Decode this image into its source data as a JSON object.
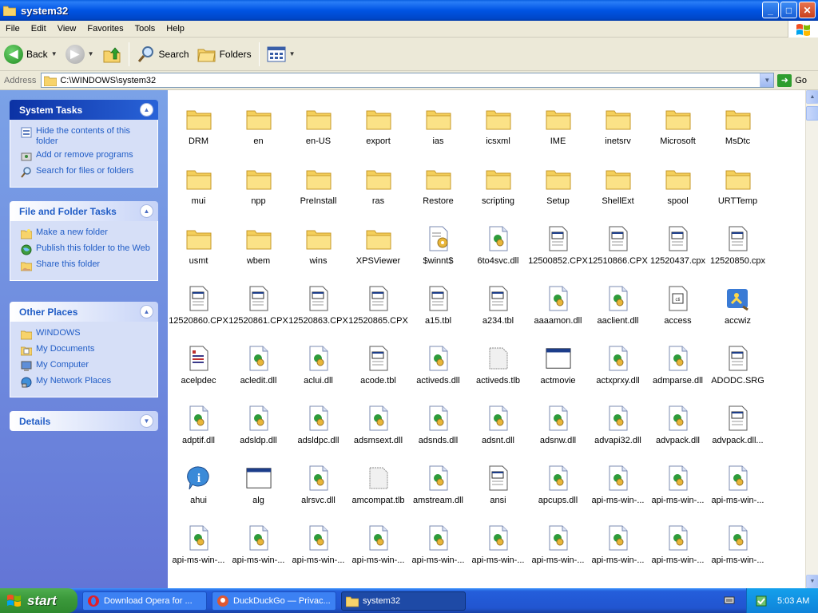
{
  "window": {
    "title": "system32",
    "buttons": {
      "minimize": "_",
      "maximize": "□",
      "close": "✕"
    }
  },
  "menu": [
    "File",
    "Edit",
    "View",
    "Favorites",
    "Tools",
    "Help"
  ],
  "toolbar": {
    "back": "Back",
    "search": "Search",
    "folders": "Folders"
  },
  "address": {
    "label": "Address",
    "path": "C:\\WINDOWS\\system32",
    "go": "Go"
  },
  "taskpane": {
    "system_tasks": {
      "title": "System Tasks",
      "items": [
        "Hide the contents of this folder",
        "Add or remove programs",
        "Search for files or folders"
      ]
    },
    "file_folder_tasks": {
      "title": "File and Folder Tasks",
      "items": [
        "Make a new folder",
        "Publish this folder to the Web",
        "Share this folder"
      ]
    },
    "other_places": {
      "title": "Other Places",
      "items": [
        "WINDOWS",
        "My Documents",
        "My Computer",
        "My Network Places"
      ]
    },
    "details": {
      "title": "Details"
    }
  },
  "files": [
    {
      "name": "DRM",
      "type": "folder"
    },
    {
      "name": "en",
      "type": "folder"
    },
    {
      "name": "en-US",
      "type": "folder"
    },
    {
      "name": "export",
      "type": "folder"
    },
    {
      "name": "ias",
      "type": "folder"
    },
    {
      "name": "icsxml",
      "type": "folder"
    },
    {
      "name": "IME",
      "type": "folder"
    },
    {
      "name": "inetsrv",
      "type": "folder"
    },
    {
      "name": "Microsoft",
      "type": "folder"
    },
    {
      "name": "MsDtc",
      "type": "folder"
    },
    {
      "name": "mui",
      "type": "folder"
    },
    {
      "name": "npp",
      "type": "folder"
    },
    {
      "name": "PreInstall",
      "type": "folder"
    },
    {
      "name": "ras",
      "type": "folder"
    },
    {
      "name": "Restore",
      "type": "folder"
    },
    {
      "name": "scripting",
      "type": "folder"
    },
    {
      "name": "Setup",
      "type": "folder"
    },
    {
      "name": "ShellExt",
      "type": "folder"
    },
    {
      "name": "spool",
      "type": "folder"
    },
    {
      "name": "URTTemp",
      "type": "folder"
    },
    {
      "name": "usmt",
      "type": "folder"
    },
    {
      "name": "wbem",
      "type": "folder"
    },
    {
      "name": "wins",
      "type": "folder"
    },
    {
      "name": "XPSViewer",
      "type": "folder"
    },
    {
      "name": "$winnt$",
      "type": "config"
    },
    {
      "name": "6to4svc.dll",
      "type": "dll"
    },
    {
      "name": "12500852.CPX",
      "type": "cpx"
    },
    {
      "name": "12510866.CPX",
      "type": "cpx"
    },
    {
      "name": "12520437.cpx",
      "type": "cpx"
    },
    {
      "name": "12520850.cpx",
      "type": "cpx"
    },
    {
      "name": "12520860.CPX",
      "type": "cpx"
    },
    {
      "name": "12520861.CPX",
      "type": "cpx"
    },
    {
      "name": "12520863.CPX",
      "type": "cpx"
    },
    {
      "name": "12520865.CPX",
      "type": "cpx"
    },
    {
      "name": "a15.tbl",
      "type": "cpx"
    },
    {
      "name": "a234.tbl",
      "type": "cpx"
    },
    {
      "name": "aaaamon.dll",
      "type": "dll"
    },
    {
      "name": "aaclient.dll",
      "type": "dll"
    },
    {
      "name": "access",
      "type": "cpl"
    },
    {
      "name": "accwiz",
      "type": "accwiz"
    },
    {
      "name": "acelpdec",
      "type": "codec"
    },
    {
      "name": "acledit.dll",
      "type": "dll"
    },
    {
      "name": "aclui.dll",
      "type": "dll"
    },
    {
      "name": "acode.tbl",
      "type": "cpx"
    },
    {
      "name": "activeds.dll",
      "type": "dll"
    },
    {
      "name": "activeds.tlb",
      "type": "tlb"
    },
    {
      "name": "actmovie",
      "type": "exe"
    },
    {
      "name": "actxprxy.dll",
      "type": "dll"
    },
    {
      "name": "admparse.dll",
      "type": "dll"
    },
    {
      "name": "ADODC.SRG",
      "type": "cpx"
    },
    {
      "name": "adptif.dll",
      "type": "dll"
    },
    {
      "name": "adsldp.dll",
      "type": "dll"
    },
    {
      "name": "adsldpc.dll",
      "type": "dll"
    },
    {
      "name": "adsmsext.dll",
      "type": "dll"
    },
    {
      "name": "adsnds.dll",
      "type": "dll"
    },
    {
      "name": "adsnt.dll",
      "type": "dll"
    },
    {
      "name": "adsnw.dll",
      "type": "dll"
    },
    {
      "name": "advapi32.dll",
      "type": "dll"
    },
    {
      "name": "advpack.dll",
      "type": "dll"
    },
    {
      "name": "advpack.dll...",
      "type": "cpx"
    },
    {
      "name": "ahui",
      "type": "info"
    },
    {
      "name": "alg",
      "type": "exe"
    },
    {
      "name": "alrsvc.dll",
      "type": "dll"
    },
    {
      "name": "amcompat.tlb",
      "type": "tlb"
    },
    {
      "name": "amstream.dll",
      "type": "dll"
    },
    {
      "name": "ansi",
      "type": "cpx"
    },
    {
      "name": "apcups.dll",
      "type": "dll"
    },
    {
      "name": "api-ms-win-...",
      "type": "dll"
    },
    {
      "name": "api-ms-win-...",
      "type": "dll"
    },
    {
      "name": "api-ms-win-...",
      "type": "dll"
    },
    {
      "name": "api-ms-win-...",
      "type": "dll"
    },
    {
      "name": "api-ms-win-...",
      "type": "dll"
    },
    {
      "name": "api-ms-win-...",
      "type": "dll"
    },
    {
      "name": "api-ms-win-...",
      "type": "dll"
    },
    {
      "name": "api-ms-win-...",
      "type": "dll"
    },
    {
      "name": "api-ms-win-...",
      "type": "dll"
    },
    {
      "name": "api-ms-win-...",
      "type": "dll"
    },
    {
      "name": "api-ms-win-...",
      "type": "dll"
    },
    {
      "name": "api-ms-win-...",
      "type": "dll"
    },
    {
      "name": "api-ms-win-...",
      "type": "dll"
    }
  ],
  "taskbar": {
    "start": "start",
    "tasks": [
      {
        "label": "Download Opera for ...",
        "icon": "opera-icon"
      },
      {
        "label": "DuckDuckGo — Privac...",
        "icon": "duckduckgo-icon"
      },
      {
        "label": "system32",
        "icon": "folder-icon",
        "active": true
      }
    ],
    "clock": "5:03 AM"
  },
  "colors": {
    "titlebar": "#0054e3",
    "taskpane": "#6d8ee0",
    "link": "#215dc6",
    "taskbar": "#245edb",
    "start": "#3c9a3c"
  }
}
